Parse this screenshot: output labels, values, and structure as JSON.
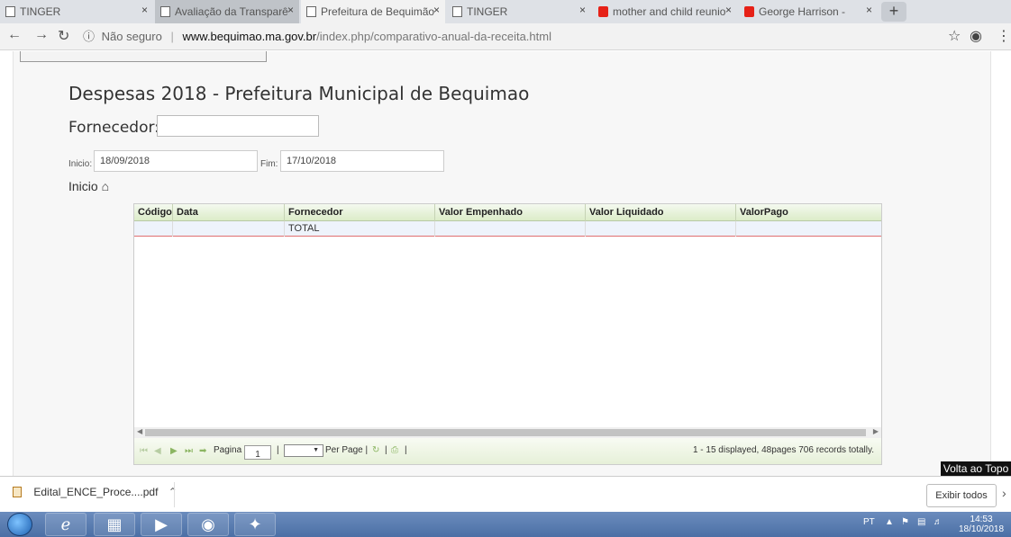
{
  "browser": {
    "tabs": [
      {
        "title": "TINGER",
        "active": false
      },
      {
        "title": "Avaliação da Transparê",
        "active": false
      },
      {
        "title": "Prefeitura de Bequimão",
        "active": true
      },
      {
        "title": "TINGER",
        "active": false
      },
      {
        "title": "mother and child reunio",
        "active": false
      },
      {
        "title": "George Harrison -",
        "active": false
      }
    ],
    "tab_close_glyph": "×",
    "newtab_glyph": "+",
    "address": {
      "security_label": "Não seguro",
      "domain": "www.bequimao.ma.gov.br",
      "path": "/index.php/comparativo-anual-da-receita.html"
    }
  },
  "page": {
    "title": "Despesas 2018 - Prefeitura Municipal de Bequimao",
    "fornecedor_label": "Fornecedor:",
    "fornecedor_value": "",
    "inicio_label": "Inicio:",
    "inicio_value": "18/09/2018",
    "fim_label": "Fim:",
    "fim_value": "17/10/2018",
    "inicio_link": "Inicio"
  },
  "grid": {
    "columns": [
      "Código",
      "Data",
      "Fornecedor",
      "Valor Empenhado",
      "Valor Liquidado",
      "ValorPago"
    ],
    "rows": [
      [
        "",
        "",
        "TOTAL",
        "",
        "",
        ""
      ]
    ],
    "pager": {
      "page_label": "Pagina",
      "page_value": "1",
      "per_page_label": "Per Page |",
      "separator": "|",
      "summary": "1 - 15 displayed, 48pages 706 records totally."
    }
  },
  "back_to_top": "Volta ao Topo",
  "downloads": {
    "file": "Edital_ENCE_Proce....pdf",
    "show_all": "Exibir todos"
  },
  "taskbar": {
    "lang": "PT",
    "time": "14:53",
    "date": "18/10/2018"
  }
}
